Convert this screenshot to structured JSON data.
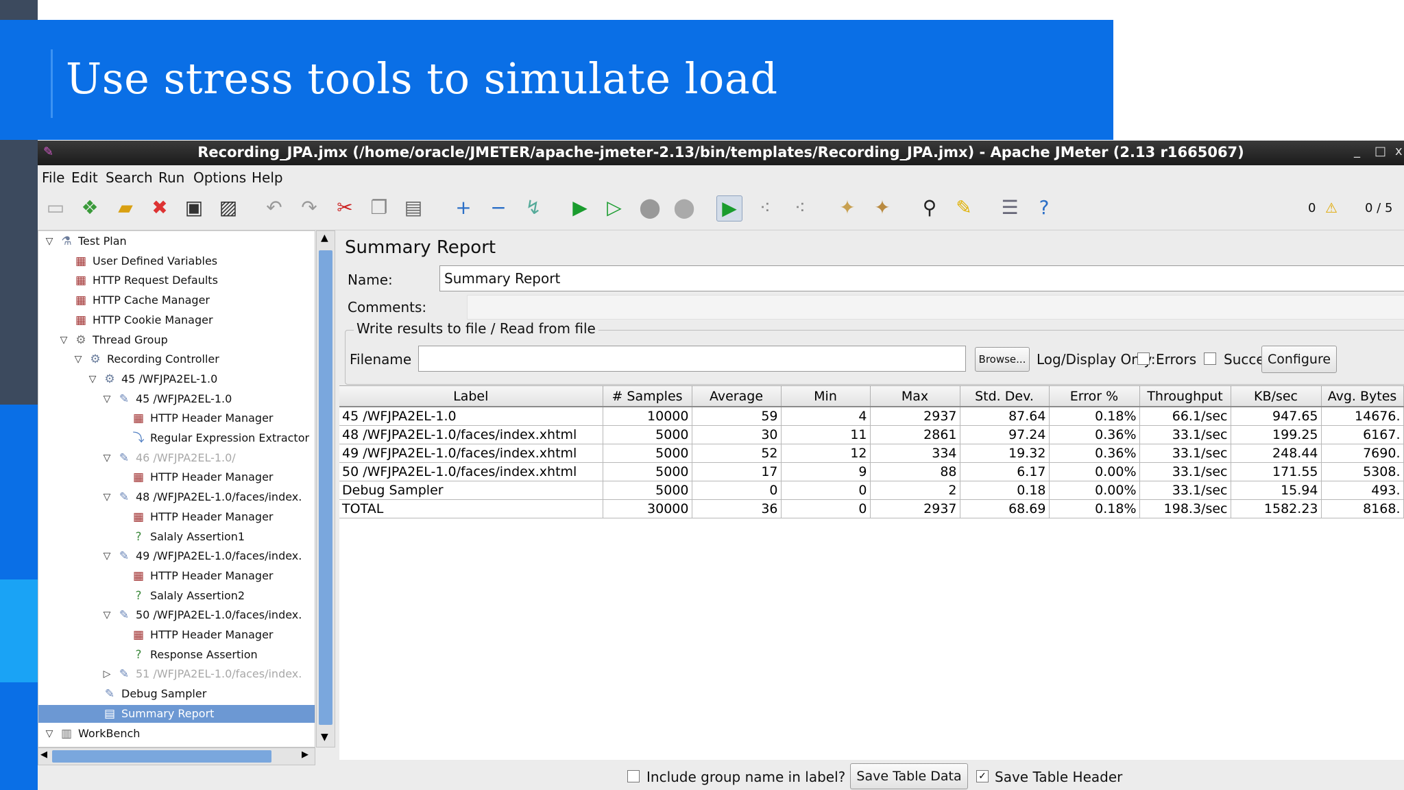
{
  "slide": {
    "title": "Use stress tools to simulate load"
  },
  "window": {
    "title": "Recording_JPA.jmx (/home/oracle/JMETER/apache-jmeter-2.13/bin/templates/Recording_JPA.jmx) - Apache JMeter (2.13 r1665067)",
    "controls": [
      "_",
      "□",
      "x"
    ]
  },
  "menu": [
    "File",
    "Edit",
    "Search",
    "Run",
    "Options",
    "Help"
  ],
  "toolbar": {
    "icons": [
      "new-icon",
      "templates-icon",
      "open-icon",
      "close-icon",
      "save-icon",
      "save-as-icon",
      "undo-icon",
      "redo-icon",
      "cut-icon",
      "copy-icon",
      "paste-icon",
      "expand-icon",
      "collapse-icon",
      "toggle-icon",
      "start-icon",
      "start-no-pause-icon",
      "stop-icon",
      "shutdown-icon",
      "remote-start-icon",
      "remote-stop-icon",
      "remote-shutdown-icon",
      "clear-icon",
      "clear-all-icon",
      "search-icon",
      "reset-search-icon",
      "function-helper-icon",
      "help-icon"
    ],
    "warning_count": "0",
    "threads": "0 / 5"
  },
  "tree": [
    {
      "label": "Test Plan",
      "level": 0,
      "twisty": "open",
      "icon": "beaker-icon"
    },
    {
      "label": "User Defined Variables",
      "level": 1,
      "icon": "config-icon"
    },
    {
      "label": "HTTP Request Defaults",
      "level": 1,
      "icon": "config-icon"
    },
    {
      "label": "HTTP Cache Manager",
      "level": 1,
      "icon": "config-icon"
    },
    {
      "label": "HTTP Cookie Manager",
      "level": 1,
      "icon": "config-icon"
    },
    {
      "label": "Thread Group",
      "level": 1,
      "twisty": "open",
      "icon": "thread-group-icon"
    },
    {
      "label": "Recording Controller",
      "level": 2,
      "twisty": "open",
      "icon": "controller-icon"
    },
    {
      "label": "45 /WFJPA2EL-1.0",
      "level": 3,
      "twisty": "open",
      "icon": "controller-icon"
    },
    {
      "label": "45 /WFJPA2EL-1.0",
      "level": 4,
      "twisty": "open",
      "icon": "sampler-icon"
    },
    {
      "label": "HTTP Header Manager",
      "level": 5,
      "icon": "config-icon"
    },
    {
      "label": "Regular Expression Extractor",
      "level": 5,
      "icon": "extractor-icon"
    },
    {
      "label": "46 /WFJPA2EL-1.0/",
      "level": 4,
      "twisty": "open",
      "icon": "sampler-icon",
      "disabled": true
    },
    {
      "label": "HTTP Header Manager",
      "level": 5,
      "icon": "config-icon"
    },
    {
      "label": "48 /WFJPA2EL-1.0/faces/index.",
      "level": 4,
      "twisty": "open",
      "icon": "sampler-icon"
    },
    {
      "label": "HTTP Header Manager",
      "level": 5,
      "icon": "config-icon"
    },
    {
      "label": "Salaly Assertion1",
      "level": 5,
      "icon": "assertion-icon"
    },
    {
      "label": "49 /WFJPA2EL-1.0/faces/index.",
      "level": 4,
      "twisty": "open",
      "icon": "sampler-icon"
    },
    {
      "label": "HTTP Header Manager",
      "level": 5,
      "icon": "config-icon"
    },
    {
      "label": "Salaly Assertion2",
      "level": 5,
      "icon": "assertion-icon"
    },
    {
      "label": "50 /WFJPA2EL-1.0/faces/index.",
      "level": 4,
      "twisty": "open",
      "icon": "sampler-icon"
    },
    {
      "label": "HTTP Header Manager",
      "level": 5,
      "icon": "config-icon"
    },
    {
      "label": "Response Assertion",
      "level": 5,
      "icon": "assertion-icon"
    },
    {
      "label": "51 /WFJPA2EL-1.0/faces/index.",
      "level": 4,
      "twisty": "closed",
      "icon": "sampler-icon",
      "disabled": true
    },
    {
      "label": "Debug Sampler",
      "level": 3,
      "icon": "sampler-icon"
    },
    {
      "label": "Summary Report",
      "level": 3,
      "icon": "listener-icon",
      "selected": true
    },
    {
      "label": "WorkBench",
      "level": 0,
      "twisty": "open",
      "icon": "workbench-icon"
    }
  ],
  "report": {
    "heading": "Summary Report",
    "name_label": "Name:",
    "name_value": "Summary Report",
    "comments_label": "Comments:",
    "group_title": "Write results to file / Read from file",
    "filename_label": "Filename",
    "filename_value": "",
    "browse_label": "Browse...",
    "log_display_label": "Log/Display Only:",
    "errors_label": "Errors",
    "successes_label": "Successes",
    "configure_label": "Configure"
  },
  "table": {
    "columns": [
      "Label",
      "# Samples",
      "Average",
      "Min",
      "Max",
      "Std. Dev.",
      "Error %",
      "Throughput",
      "KB/sec",
      "Avg. Bytes"
    ],
    "rows": [
      [
        "45 /WFJPA2EL-1.0",
        "10000",
        "59",
        "4",
        "2937",
        "87.64",
        "0.18%",
        "66.1/sec",
        "947.65",
        "14676."
      ],
      [
        "48 /WFJPA2EL-1.0/faces/index.xhtml",
        "5000",
        "30",
        "11",
        "2861",
        "97.24",
        "0.36%",
        "33.1/sec",
        "199.25",
        "6167."
      ],
      [
        "49 /WFJPA2EL-1.0/faces/index.xhtml",
        "5000",
        "52",
        "12",
        "334",
        "19.32",
        "0.36%",
        "33.1/sec",
        "248.44",
        "7690."
      ],
      [
        "50 /WFJPA2EL-1.0/faces/index.xhtml",
        "5000",
        "17",
        "9",
        "88",
        "6.17",
        "0.00%",
        "33.1/sec",
        "171.55",
        "5308."
      ],
      [
        "Debug Sampler",
        "5000",
        "0",
        "0",
        "2",
        "0.18",
        "0.00%",
        "33.1/sec",
        "15.94",
        "493."
      ],
      [
        "TOTAL",
        "30000",
        "36",
        "0",
        "2937",
        "68.69",
        "0.18%",
        "198.3/sec",
        "1582.23",
        "8168."
      ]
    ]
  },
  "footer": {
    "include_group_label": "Include group name in label?",
    "save_table_data_label": "Save Table Data",
    "save_table_header_label": "Save Table Header",
    "save_table_header_checked": true
  },
  "colors": {
    "banner_blue": "#0a6fe6",
    "selection_blue": "#6c98d3",
    "left_strip_dark": "#3c4a5e",
    "left_strip_light": "#1aa3f5"
  }
}
